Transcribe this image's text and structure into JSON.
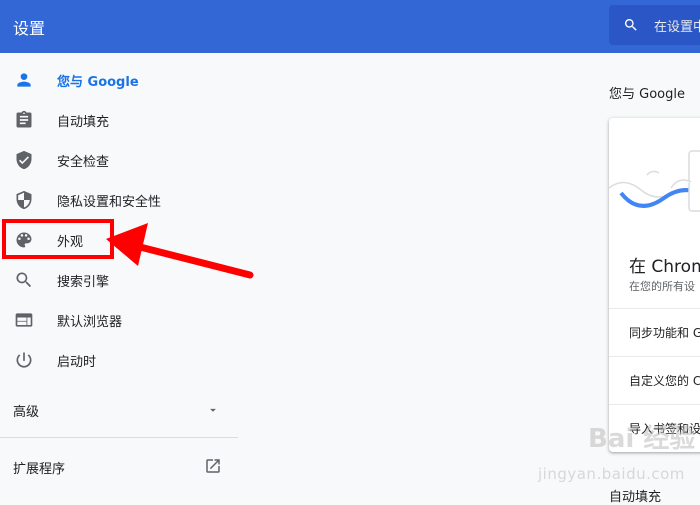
{
  "header": {
    "title": "设置",
    "search_placeholder": "在设置中"
  },
  "sidebar": {
    "items": [
      {
        "label": "您与 Google",
        "icon": "person-icon",
        "active": true
      },
      {
        "label": "自动填充",
        "icon": "clipboard-icon"
      },
      {
        "label": "安全检查",
        "icon": "shield-check-icon"
      },
      {
        "label": "隐私设置和安全性",
        "icon": "shield-half-icon"
      },
      {
        "label": "外观",
        "icon": "palette-icon"
      },
      {
        "label": "搜索引擎",
        "icon": "search-icon"
      },
      {
        "label": "默认浏览器",
        "icon": "browser-icon"
      },
      {
        "label": "启动时",
        "icon": "power-icon"
      }
    ],
    "advanced_label": "高级",
    "extensions_label": "扩展程序"
  },
  "main": {
    "section_title": "您与 Google",
    "card": {
      "heading": "在 Chrom",
      "subtitle": "在您的所有设",
      "rows": [
        "同步功能和 G",
        "自定义您的 C",
        "导入书签和设"
      ]
    },
    "bottom_section_title": "自动填充"
  },
  "watermark": {
    "brand": "Bai 经验",
    "url": "jingyan.baidu.com"
  },
  "colors": {
    "header": "#3367d6",
    "accent": "#1a73e8",
    "annotation": "#ff0000"
  }
}
